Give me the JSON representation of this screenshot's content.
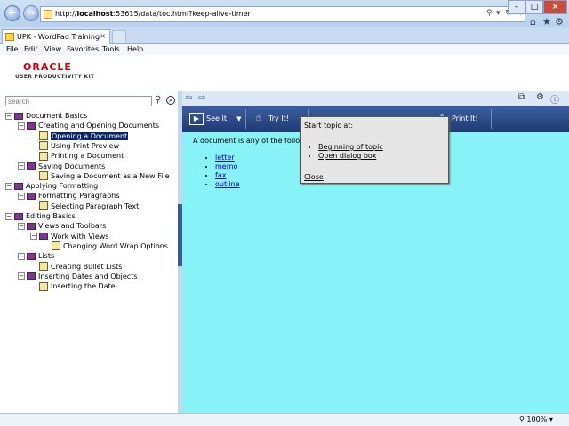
{
  "browser": {
    "url_prefix": "http://",
    "url_host": "localhost",
    "url_rest": ":53615/data/toc.html?keep-alive-timer",
    "tab_title": "UPK - WordPad Training",
    "menu": [
      "File",
      "Edit",
      "View",
      "Favorites",
      "Tools",
      "Help"
    ],
    "zoom": "100%"
  },
  "header": {
    "logo": "ORACLE",
    "subtitle": "USER PRODUCTIVITY KIT"
  },
  "toc": {
    "search_placeholder": "search",
    "items": [
      {
        "label": "Document Basics",
        "level": 0,
        "kind": "book",
        "expanded": true
      },
      {
        "label": "Creating and Opening Documents",
        "level": 1,
        "kind": "book",
        "expanded": true
      },
      {
        "label": "Opening a Document",
        "level": 2,
        "kind": "topic",
        "selected": true
      },
      {
        "label": "Using Print Preview",
        "level": 2,
        "kind": "topic"
      },
      {
        "label": "Printing a Document",
        "level": 2,
        "kind": "topic"
      },
      {
        "label": "Saving Documents",
        "level": 1,
        "kind": "book",
        "expanded": true
      },
      {
        "label": "Saving a Document as a New File",
        "level": 2,
        "kind": "topic"
      },
      {
        "label": "Applying Formatting",
        "level": 0,
        "kind": "book",
        "expanded": true
      },
      {
        "label": "Formatting Paragraphs",
        "level": 1,
        "kind": "book",
        "expanded": true
      },
      {
        "label": "Selecting Paragraph Text",
        "level": 2,
        "kind": "topic"
      },
      {
        "label": "Editing Basics",
        "level": 0,
        "kind": "book",
        "expanded": true
      },
      {
        "label": "Views and Toolbars",
        "level": 1,
        "kind": "book",
        "expanded": true
      },
      {
        "label": "Work with Views",
        "level": 2,
        "kind": "book",
        "expanded": true
      },
      {
        "label": "Changing Word Wrap Options",
        "level": 3,
        "kind": "topic"
      },
      {
        "label": "Lists",
        "level": 1,
        "kind": "book",
        "expanded": true
      },
      {
        "label": "Creating Bullet Lists",
        "level": 2,
        "kind": "topic"
      },
      {
        "label": "Inserting Dates and Objects",
        "level": 1,
        "kind": "book",
        "expanded": true
      },
      {
        "label": "Inserting the Date",
        "level": 2,
        "kind": "topic"
      }
    ]
  },
  "modes": {
    "see_it": "See It!",
    "try_it": "Try It!",
    "print_it": "Print It!"
  },
  "content": {
    "lead": "A document is any of the followi",
    "links": [
      "letter",
      "memo",
      "fax",
      "outline"
    ]
  },
  "popup": {
    "title": "Start topic at:",
    "options": [
      "Beginning of topic",
      "Open dialog box"
    ],
    "close": "Close"
  }
}
